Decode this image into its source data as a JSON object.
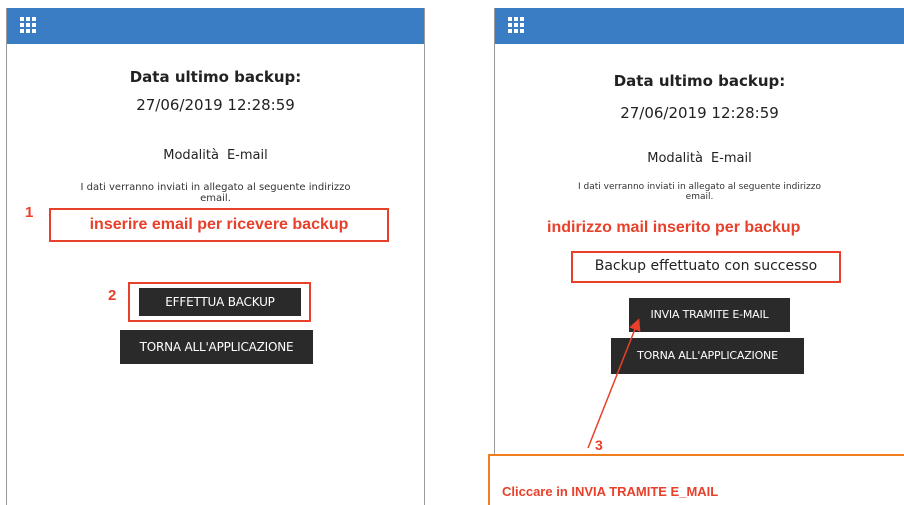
{
  "left_panel": {
    "title": "Data ultimo backup:",
    "datetime": "27/06/2019 12:28:59",
    "mode_label": "Modalità",
    "mode_value": "E-mail",
    "info_line1": "I dati verranno inviati in allegato al seguente indirizzo",
    "info_line2": "email.",
    "step1": "1",
    "email_placeholder": "inserire email per ricevere backup",
    "step2": "2",
    "backup_button": "EFFETTUA BACKUP",
    "return_button": "TORNA ALL'APPLICAZIONE"
  },
  "right_panel": {
    "title": "Data ultimo backup:",
    "datetime": "27/06/2019 12:28:59",
    "mode_label": "Modalità",
    "mode_value": "E-mail",
    "info_line1": "I dati verranno inviati in allegato al seguente indirizzo",
    "info_line2": "email.",
    "email_value": "indirizzo mail inserito per backup",
    "success_message": "Backup effettuato con successo",
    "send_button": "INVIA TRAMITE E-MAIL",
    "return_button": "TORNA ALL'APPLICAZIONE",
    "step3": "3",
    "callout": "Cliccare in INVIA TRAMITE E_MAIL"
  },
  "colors": {
    "topbar": "#3b7dc4",
    "annotation_red": "#e8402a",
    "callout_orange": "#f07d1e",
    "button_dark": "#2a2a2a"
  }
}
